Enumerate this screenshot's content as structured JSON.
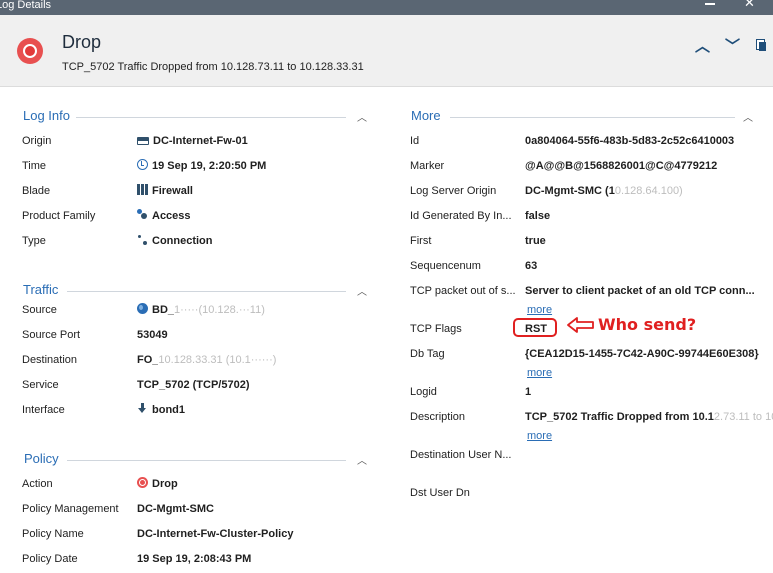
{
  "window": {
    "title": "Log Details"
  },
  "header": {
    "title": "Drop",
    "subtitle": "TCP_5702 Traffic Dropped from 10.128.73.11 to 10.128.33.31",
    "status_color": "#e85050"
  },
  "log_info": {
    "title": "Log Info",
    "rows": [
      {
        "label": "Origin",
        "value": "DC-Internet-Fw-01",
        "icon": "firewall-gateway-icon"
      },
      {
        "label": "Time",
        "value": "19 Sep 19, 2:20:50 PM",
        "icon": "clock-icon"
      },
      {
        "label": "Blade",
        "value": "Firewall",
        "icon": "firewall-blade-icon"
      },
      {
        "label": "Product Family",
        "value": "Access",
        "icon": "access-icon"
      },
      {
        "label": "Type",
        "value": "Connection",
        "icon": "connection-icon"
      }
    ]
  },
  "traffic": {
    "title": "Traffic",
    "rows": [
      {
        "label": "Source",
        "value": "BD_",
        "redacted": "1·····(10.128.···11)",
        "icon": "globe-icon"
      },
      {
        "label": "Source Port",
        "value": "53049"
      },
      {
        "label": "Destination",
        "value": "FO_",
        "redacted": "10.128.33.31 (10.1······)",
        "icon": ""
      },
      {
        "label": "Service",
        "value": "TCP_5702 (TCP/5702)"
      },
      {
        "label": "Interface",
        "value": "bond1",
        "icon": "download-arrow-icon"
      }
    ]
  },
  "policy": {
    "title": "Policy",
    "rows": [
      {
        "label": "Action",
        "value": "Drop",
        "icon": "drop-icon"
      },
      {
        "label": "Policy Management",
        "value": "DC-Mgmt-SMC"
      },
      {
        "label": "Policy Name",
        "value": "DC-Internet-Fw-Cluster-Policy"
      },
      {
        "label": "Policy Date",
        "value": "19 Sep 19, 2:08:43 PM"
      }
    ]
  },
  "more": {
    "title": "More",
    "rows": [
      {
        "label": "Id",
        "value": "0a804064-55f6-483b-5d83-2c52c6410003"
      },
      {
        "label": "Marker",
        "value": "@A@@B@1568826001@C@4779212"
      },
      {
        "label": "Log Server Origin",
        "value": "DC-Mgmt-SMC (1",
        "redacted": "0.128.64.100)"
      },
      {
        "label": "Id Generated By In...",
        "value": "false"
      },
      {
        "label": "First",
        "value": "true"
      },
      {
        "label": "Sequencenum",
        "value": "63"
      },
      {
        "label": "TCP packet out of s...",
        "value": "Server to client packet of an old TCP conn..."
      },
      {
        "label": "TCP Flags",
        "value": "RST"
      },
      {
        "label": "Db Tag",
        "value": "{CEA12D15-1455-7C42-A90C-99744E60E308}"
      },
      {
        "label": "Logid",
        "value": "1"
      },
      {
        "label": "Description",
        "value": "TCP_5702 Traffic Dropped from 10.1",
        "redacted": "2.73.11 to 10..."
      },
      {
        "label": "Destination User N...",
        "value": ""
      },
      {
        "label": "Dst User Dn",
        "value": ""
      }
    ],
    "more_link": "more"
  },
  "annotation": {
    "text": "Who send?",
    "color": "#e02020"
  }
}
